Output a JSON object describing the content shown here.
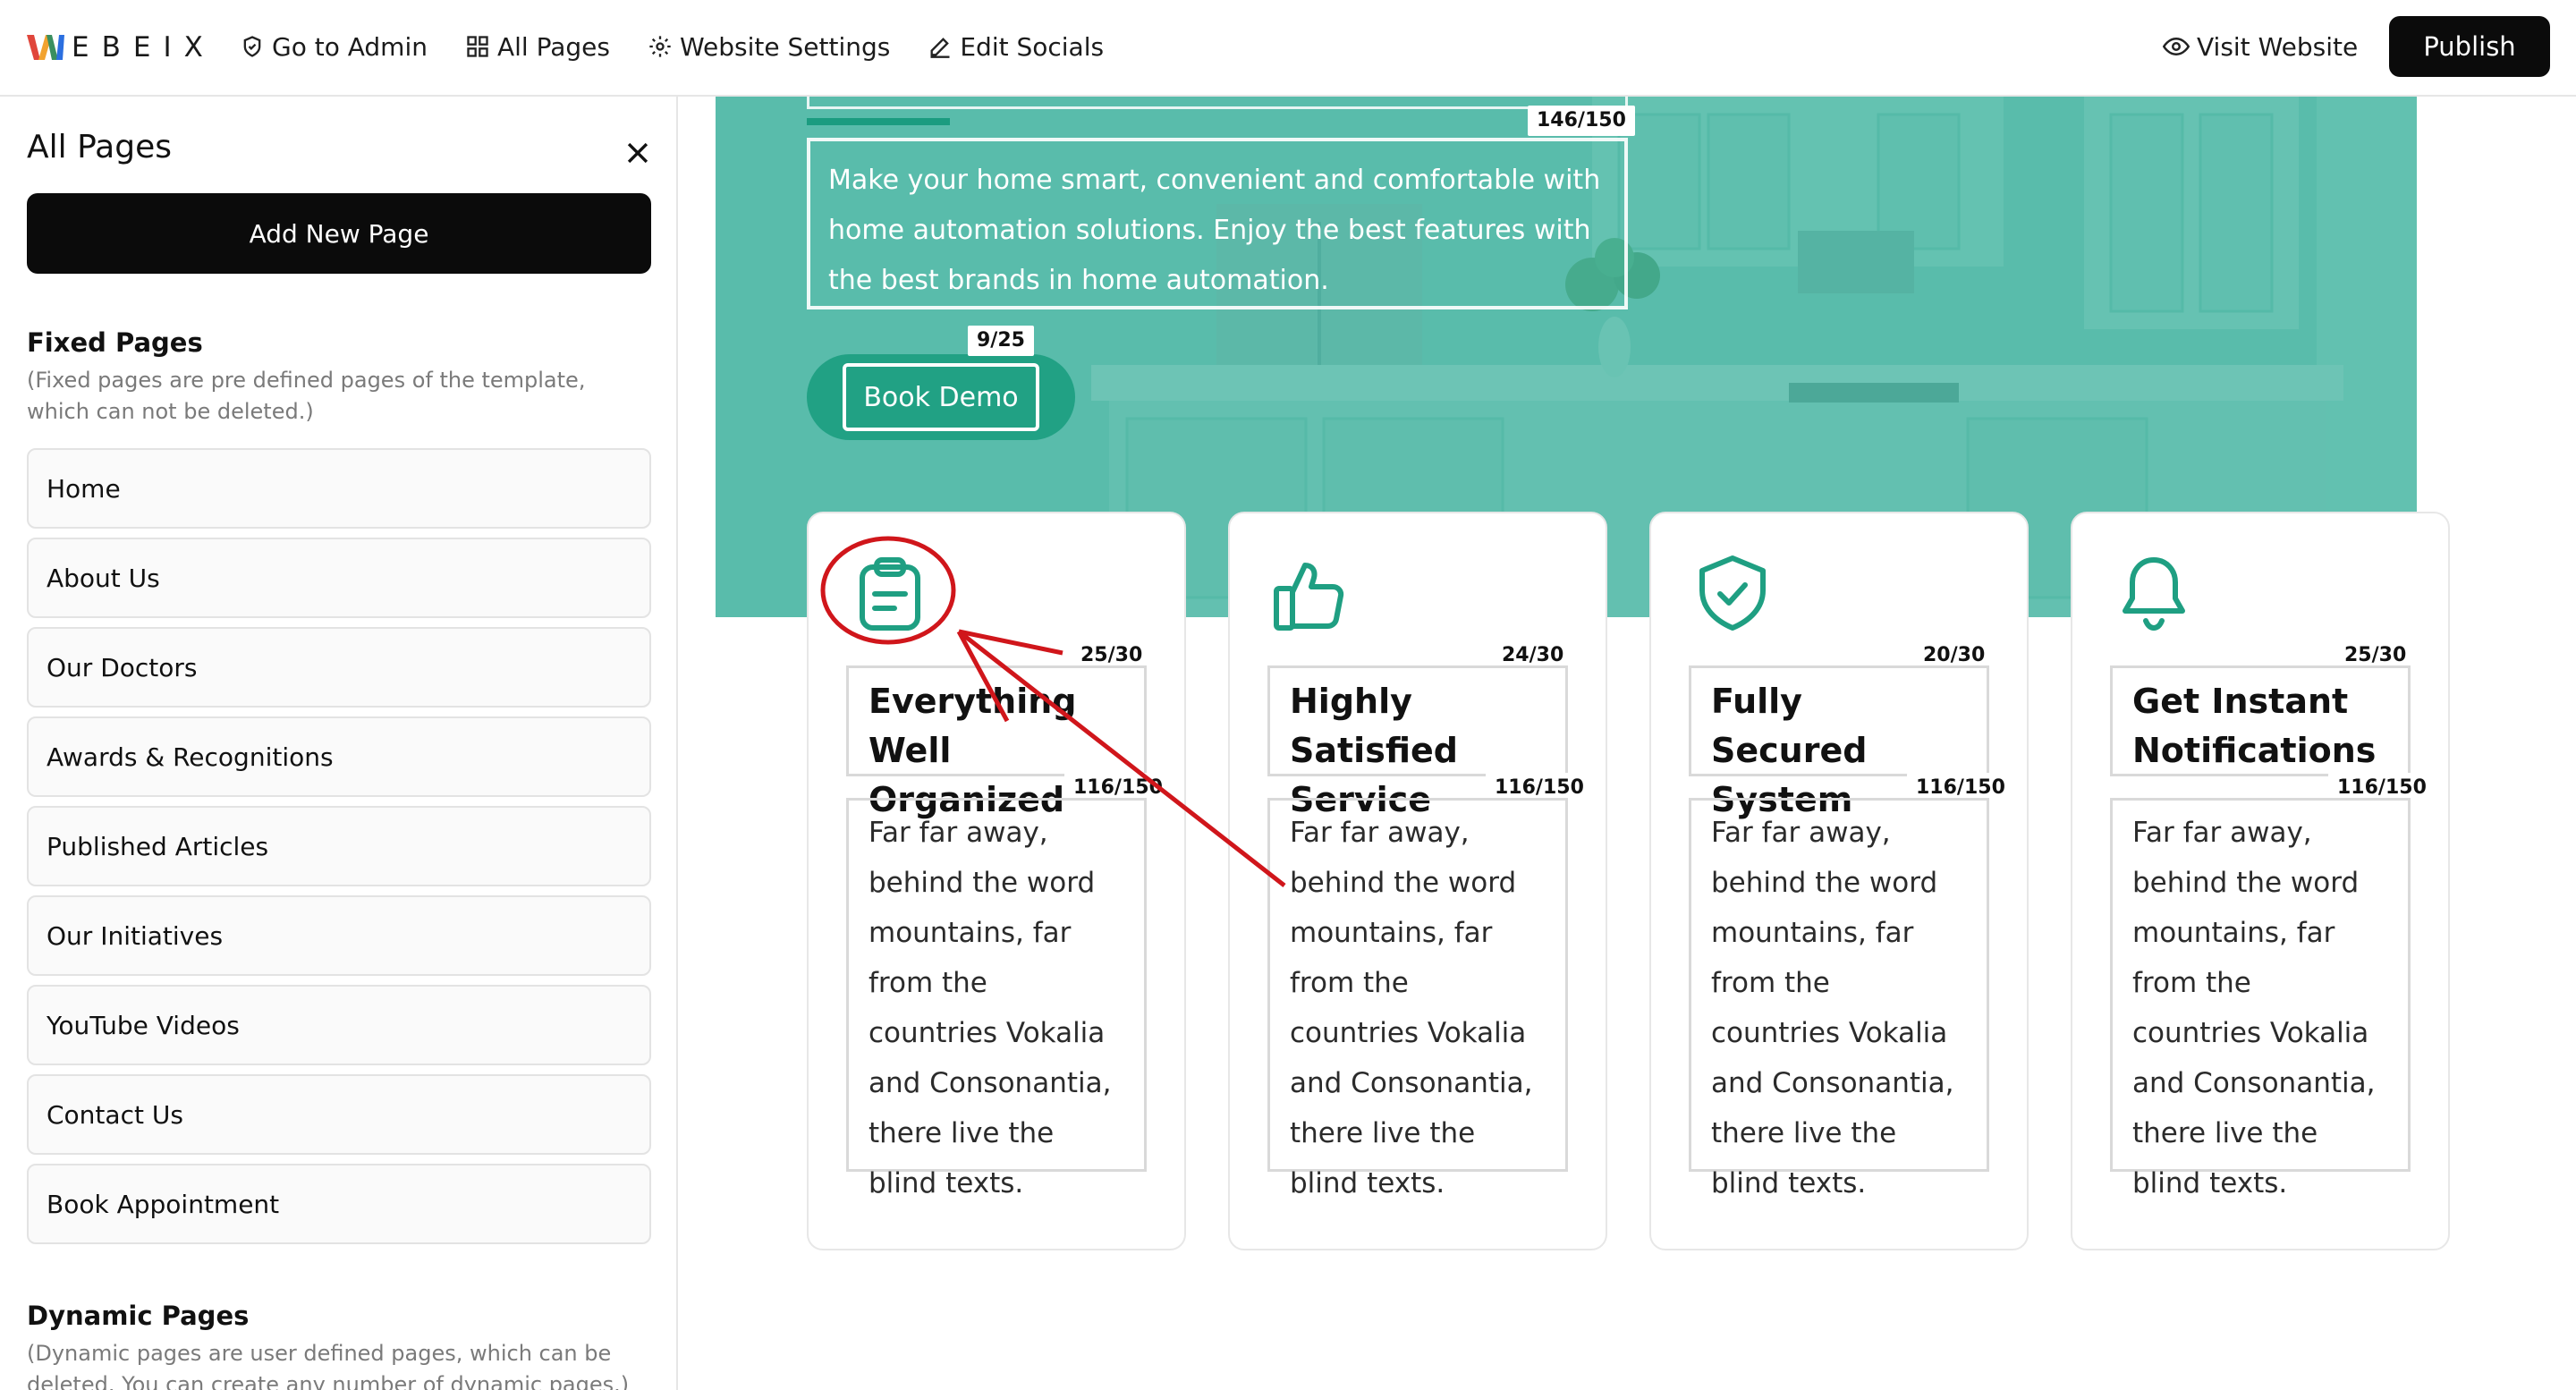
{
  "app": {
    "logo_first_letter": "W",
    "logo_rest": "EBEIX",
    "brand_colors": {
      "w_left": "#e0463b",
      "w_mid": "#f2a22e",
      "w_right": "#2b6fe0"
    }
  },
  "topbar": {
    "links": [
      {
        "label": "Go to Admin",
        "icon": "shield-icon"
      },
      {
        "label": "All Pages",
        "icon": "grid-icon"
      },
      {
        "label": "Website Settings",
        "icon": "gear-icon"
      },
      {
        "label": "Edit Socials",
        "icon": "pencil-icon"
      }
    ],
    "visit_label": "Visit Website",
    "visit_icon": "eye-icon",
    "publish_label": "Publish"
  },
  "sidebar": {
    "title": "All Pages",
    "add_page_label": "Add New Page",
    "fixed": {
      "title": "Fixed Pages",
      "note": "(Fixed pages are pre defined pages of the template, which can not be deleted.)",
      "pages": [
        "Home",
        "About Us",
        "Our Doctors",
        "Awards & Recognitions",
        "Published Articles",
        "Our Initiatives",
        "YouTube Videos",
        "Contact Us",
        "Book Appointment"
      ]
    },
    "dynamic": {
      "title": "Dynamic Pages",
      "note": "(Dynamic pages are user defined pages, which can be deleted. You can create any number of dynamic pages.)"
    }
  },
  "hero": {
    "text_counter": "146/150",
    "text": "Make your home smart, convenient and comfortable with home automation solutions. Enjoy the best features with the best brands in home automation.",
    "button_counter": "9/25",
    "button_label": "Book Demo",
    "accent_color": "#1f9f82"
  },
  "cards": [
    {
      "icon": "clipboard-icon",
      "title_counter": "25/30",
      "title": "Everything Well Organized",
      "desc_counter": "116/150",
      "desc": "Far far away, behind the word mountains, far from the countries Vokalia and Consonantia, there live the blind texts."
    },
    {
      "icon": "thumbs-up-icon",
      "title_counter": "24/30",
      "title": "Highly Satisfied Service",
      "desc_counter": "116/150",
      "desc": "Far far away, behind the word mountains, far from the countries Vokalia and Consonantia, there live the blind texts."
    },
    {
      "icon": "shield-check-icon",
      "title_counter": "20/30",
      "title": "Fully Secured System",
      "desc_counter": "116/150",
      "desc": "Far far away, behind the word mountains, far from the countries Vokalia and Consonantia, there live the blind texts."
    },
    {
      "icon": "bell-icon",
      "title_counter": "25/30",
      "title": "Get Instant Notifications",
      "desc_counter": "116/150",
      "desc": "Far far away, behind the word mountains, far from the countries Vokalia and Consonantia, there live the blind texts."
    }
  ],
  "annotation": {
    "color": "#d0161b"
  }
}
